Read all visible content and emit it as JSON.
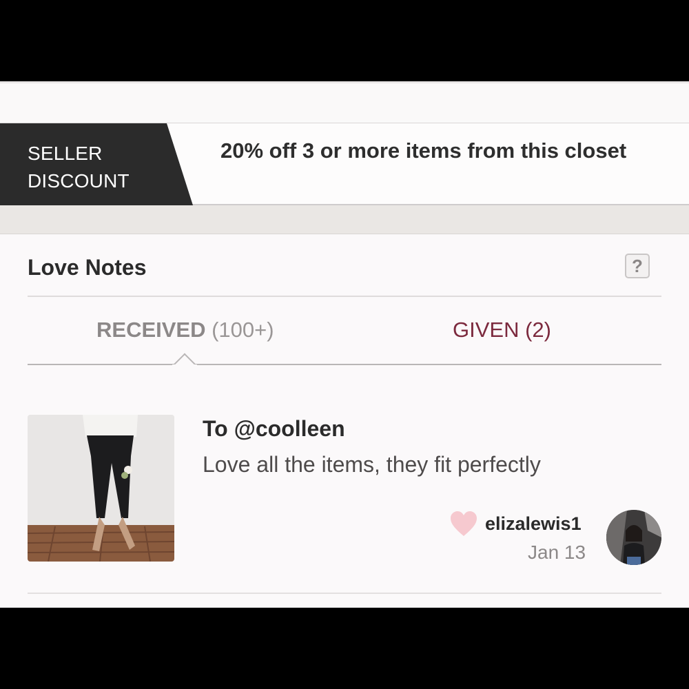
{
  "discount": {
    "tag_line1": "SELLER",
    "tag_line2": "DISCOUNT",
    "text": "20% off 3 or more items from this closet"
  },
  "love_notes": {
    "title": "Love Notes",
    "help_label": "?",
    "tabs": [
      {
        "label": "RECEIVED",
        "count": "(100+)",
        "active": true
      },
      {
        "label": "GIVEN (2)",
        "active": false
      }
    ],
    "notes": [
      {
        "to": "To @coolleen",
        "message": "Love all the items, they fit perfectly",
        "username": "elizalewis1",
        "date": "Jan 13"
      }
    ]
  },
  "colors": {
    "tag_bg": "#2b2b2b",
    "given_tab": "#7c2a3e",
    "heart": "#f6c9cf"
  },
  "icons": {
    "help": "question-mark-icon",
    "heart": "heart-icon"
  }
}
